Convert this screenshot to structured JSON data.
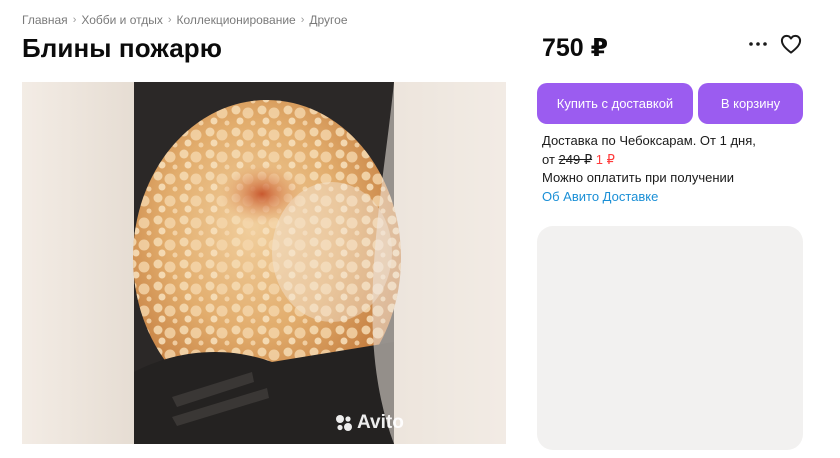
{
  "breadcrumbs": [
    "Главная",
    "Хобби и отдых",
    "Коллекционирование",
    "Другое"
  ],
  "title": "Блины пожарю",
  "price": "750 ₽",
  "icons": {
    "more": "more-dots-icon",
    "favorite": "heart-outline-icon"
  },
  "gallery": {
    "watermark": "Avito"
  },
  "buttons": {
    "buy_delivery": "Купить с доставкой",
    "cart": "В корзину"
  },
  "delivery": {
    "line1": "Доставка по Чебоксарам. От 1 дня,",
    "from": "от",
    "old_price": "249 ₽",
    "new_price": "1 ₽",
    "payment": "Можно оплатить при получении",
    "link": "Об Авито Доставке"
  },
  "colors": {
    "accent": "#9b5cf0",
    "link": "#1a8fd6",
    "discount": "#ff3b3b"
  }
}
